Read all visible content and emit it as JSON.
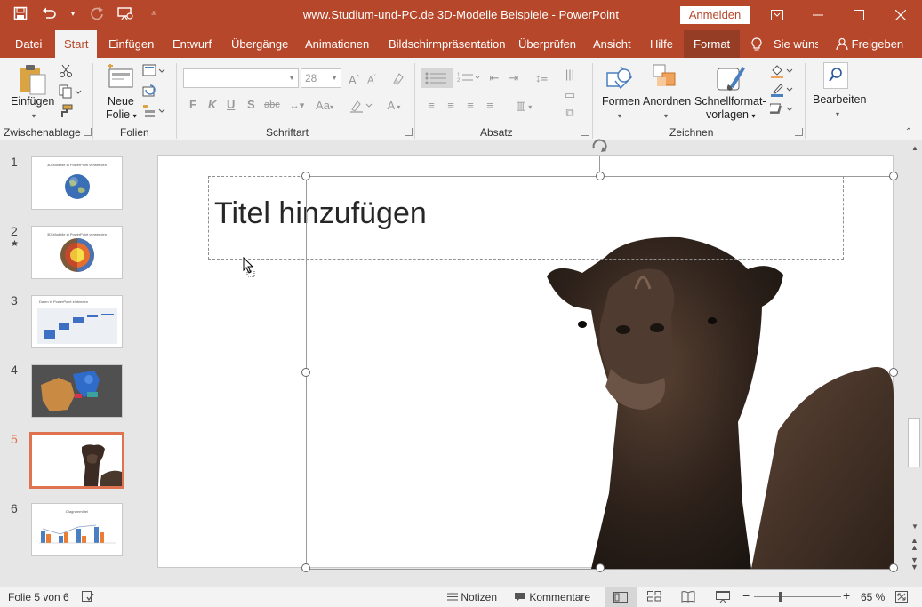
{
  "window": {
    "title": "www.Studium-und-PC.de  3D-Modelle Beispiele  -  PowerPoint",
    "signin_label": "Anmelden",
    "accent_color": "#b7472a"
  },
  "qat": {
    "save_icon": "save-icon",
    "undo_icon": "undo-icon",
    "redo_icon": "redo-icon",
    "present_icon": "present-from-start-icon",
    "customize_icon": "customize-qat-icon"
  },
  "tabs": [
    {
      "label": "Datei"
    },
    {
      "label": "Start"
    },
    {
      "label": "Einfügen"
    },
    {
      "label": "Entwurf"
    },
    {
      "label": "Übergänge"
    },
    {
      "label": "Animationen"
    },
    {
      "label": "Bildschirmpräsentation"
    },
    {
      "label": "Überprüfen"
    },
    {
      "label": "Ansicht"
    },
    {
      "label": "Hilfe"
    },
    {
      "label": "Format"
    }
  ],
  "tellme": "Sie wünsc",
  "share": "Freigeben",
  "ribbon": {
    "clipboard": {
      "paste": "Einfügen",
      "group": "Zwischenablage"
    },
    "slides": {
      "new_slide_1": "Neue",
      "new_slide_2": "Folie",
      "group": "Folien"
    },
    "font": {
      "font_name": "",
      "font_size": "28",
      "bold": "F",
      "italic": "K",
      "underline": "U",
      "shadow": "S",
      "strike": "abc",
      "group": "Schriftart"
    },
    "paragraph": {
      "group": "Absatz"
    },
    "drawing": {
      "shapes": "Formen",
      "arrange": "Anordnen",
      "quickstyles_1": "Schnellformat-",
      "quickstyles_2": "vorlagen",
      "group": "Zeichnen"
    },
    "editing": {
      "label": "Bearbeiten"
    }
  },
  "slides": [
    {
      "num": "1",
      "caption": "3D-Modelle in PowerPoint verwenden"
    },
    {
      "num": "2",
      "caption": "3D-Modelle in PowerPoint verwenden",
      "star": "★"
    },
    {
      "num": "3",
      "caption": "Daten in PowerPoint einbinden"
    },
    {
      "num": "4",
      "caption": ""
    },
    {
      "num": "5",
      "caption": ""
    },
    {
      "num": "6",
      "caption": "Diagrammtitel"
    }
  ],
  "selected_slide": 5,
  "slide": {
    "title_placeholder": "Titel hinzufügen"
  },
  "status": {
    "slide_info": "Folie 5 von 6",
    "notes": "Notizen",
    "comments": "Kommentare",
    "zoom_minus": "−",
    "zoom_plus": "+",
    "zoom": "65 %",
    "zoom_level": 0.65
  }
}
